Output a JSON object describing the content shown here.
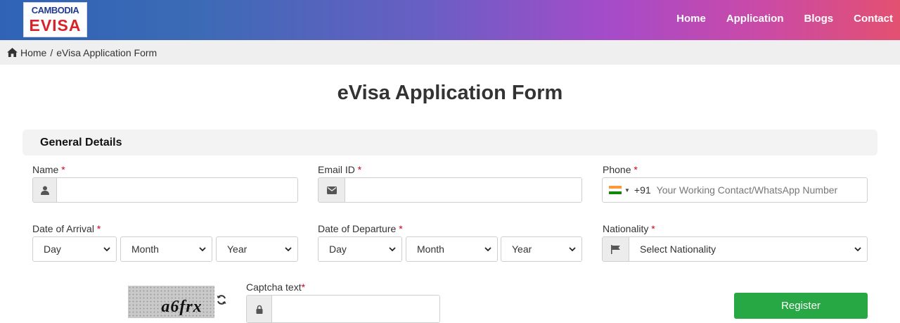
{
  "brand": {
    "line1": "CAMBODIA",
    "line2": "EVISA"
  },
  "nav": {
    "items": [
      "Home",
      "Application",
      "Blogs",
      "Contact"
    ]
  },
  "breadcrumb": {
    "home": "Home",
    "separator": "/",
    "current": "eVisa Application Form"
  },
  "page": {
    "title": "eVisa Application Form"
  },
  "section": {
    "title": "General Details"
  },
  "fields": {
    "name": {
      "label": "Name",
      "value": "",
      "icon": "user-icon"
    },
    "email": {
      "label": "Email ID",
      "value": "",
      "icon": "envelope-icon"
    },
    "phone": {
      "label": "Phone",
      "country_code": "+91",
      "placeholder": "Your Working Contact/WhatsApp Number",
      "flag": "india-flag-icon"
    },
    "arrival": {
      "label": "Date of Arrival",
      "day": "Day",
      "month": "Month",
      "year": "Year"
    },
    "departure": {
      "label": "Date of Departure",
      "day": "Day",
      "month": "Month",
      "year": "Year"
    },
    "nationality": {
      "label": "Nationality",
      "value": "Select Nationality",
      "icon": "flag-icon"
    },
    "captcha": {
      "image_text": "a6frx",
      "label": "Captcha text",
      "value": ""
    }
  },
  "required_marker": "*",
  "buttons": {
    "register": "Register"
  },
  "colors": {
    "accent_green": "#28a745",
    "required_red": "#d0021b",
    "header_start": "#2f63b6",
    "header_end": "#e35071"
  }
}
